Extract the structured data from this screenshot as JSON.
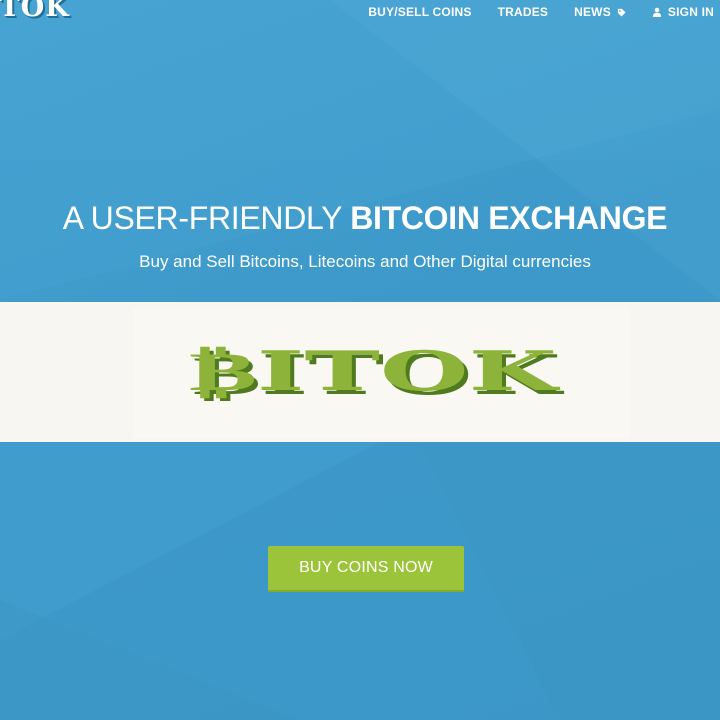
{
  "header": {
    "logo_text": "ITOK",
    "nav": {
      "buy_sell": "BUY/SELL COINS",
      "trades": "TRADES",
      "news": "NEWS",
      "sign_in": "SIGN IN"
    },
    "icons": {
      "news": "tag-icon",
      "sign_in": "user-icon"
    }
  },
  "hero": {
    "title_light": "A USER-FRIENDLY ",
    "title_bold": "BITCOIN EXCHANGE",
    "subtitle": "Buy and Sell Bitcoins, Litecoins and Other Digital currencies"
  },
  "banner": {
    "logo_text": "₿ITOK"
  },
  "cta": {
    "label": "BUY COINS NOW"
  },
  "colors": {
    "background": "#3e9bcb",
    "banner_bg": "#f7f6f2",
    "cta_green": "#9cc43a",
    "logo_green": "#8db33a",
    "logo_shadow": "#4f7a1e"
  }
}
